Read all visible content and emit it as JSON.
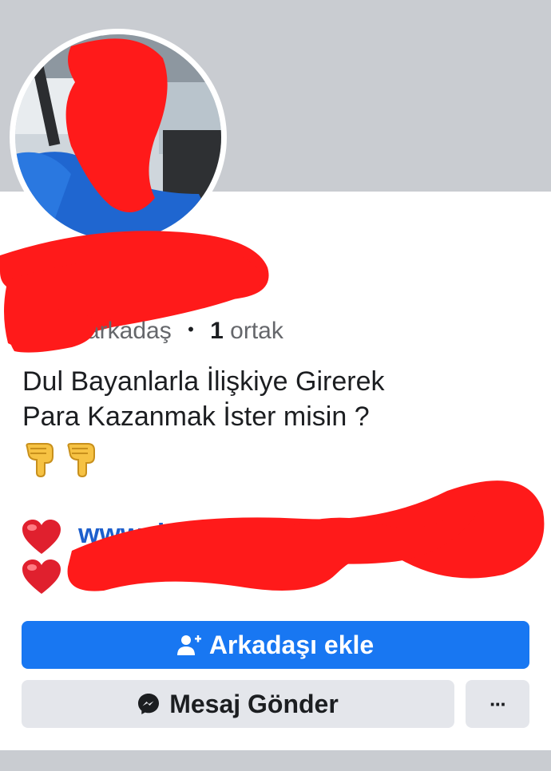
{
  "profile": {
    "friends_label": "arkadaş",
    "separator": "•",
    "mutual_count": "1",
    "mutual_label": "ortak",
    "bio_line1": "Dul Bayanlarla İlişkiye Girerek",
    "bio_line2": "Para Kazanmak İster misin ?",
    "bio_emojis": [
      "backhand-index-pointing-down",
      "backhand-index-pointing-down"
    ],
    "link_rows": [
      "red-heart",
      "red-heart"
    ],
    "link_visible_text": "www.du"
  },
  "actions": {
    "add_friend_label": "Arkadaşı ekle",
    "add_friend_icon": "add-friend-icon",
    "message_label": "Mesaj Gönder",
    "message_icon": "messenger-icon",
    "more_label": "···"
  },
  "colors": {
    "primary": "#1877f2",
    "secondary": "#e4e6eb",
    "redaction": "#ff1a1a",
    "cover": "#c9ccd1"
  }
}
